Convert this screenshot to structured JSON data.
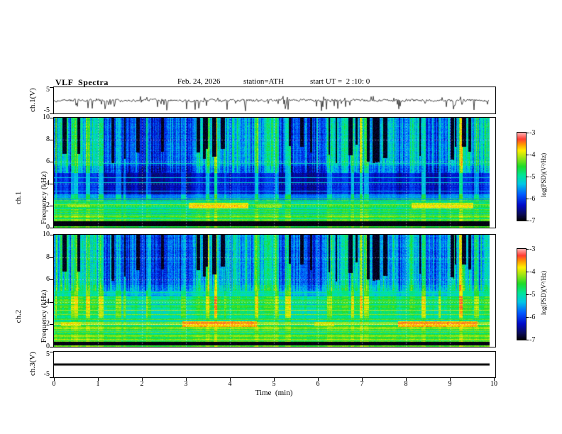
{
  "header": {
    "title": "VLF  Spectra",
    "date": "Feb. 24, 2026",
    "station": "station=ATH",
    "start_ut": "start UT =  2 :10: 0"
  },
  "axes": {
    "time_label": "Time  (min)",
    "time_ticks": [
      "0",
      "1",
      "2",
      "3",
      "4",
      "5",
      "6",
      "7",
      "8",
      "9",
      "10"
    ],
    "freq_ticks": [
      "10",
      "8",
      "6",
      "4",
      "2",
      "0"
    ],
    "volt_ticks": [
      "5",
      "-5"
    ]
  },
  "panels": {
    "ch1_wave": {
      "label": "ch.1(V)"
    },
    "ch1_spec": {
      "label_line1": "ch.1",
      "label_line2": "Frequency (kHz)"
    },
    "ch2_spec": {
      "label_line1": "ch.2",
      "label_line2": "Frequency (kHz)"
    },
    "ch3_wave": {
      "label": "ch.3(V)"
    }
  },
  "colorbar": {
    "label": "log(PSD)(V²/Hz)",
    "ticks": [
      "-3",
      "-4",
      "-5",
      "-6",
      "-7"
    ],
    "zmin": -7,
    "zmax": -3
  },
  "chart_data": [
    {
      "id": "ch1_wave",
      "type": "line",
      "ylabel": "ch.1(V)",
      "xlabel": "Time (min)",
      "xlim": [
        0,
        10
      ],
      "ylim": [
        -5,
        5
      ],
      "noise_v": 0.4,
      "spike_count": 46,
      "spike_depth_v": [
        -1.2,
        -4.6
      ],
      "spike_up_count": 16,
      "spike_up_v": [
        0.7,
        1.8
      ],
      "summary": "Broadband noisy voltage trace centered near 0 V with ~±1 V fluctuations and frequent narrow negative spikes reaching about -4.5 V across the full 0-10 min record."
    },
    {
      "id": "ch1_spec",
      "type": "heatmap",
      "ylabel": "ch.1 Frequency (kHz)",
      "xlabel": "Time (min)",
      "zlabel": "log(PSD)(V²/Hz)",
      "xlim": [
        0,
        10
      ],
      "ylim": [
        0,
        10
      ],
      "zlim": [
        -7,
        -3
      ],
      "bands": [
        [
          0,
          0.15,
          -4.6
        ],
        [
          0.15,
          0.55,
          -7
        ],
        [
          0.55,
          1.1,
          -4.65
        ],
        [
          1.1,
          2.5,
          -4.95
        ],
        [
          2.5,
          3.05,
          -5.6
        ],
        [
          3.05,
          5.0,
          -6.25
        ],
        [
          5.0,
          5.6,
          -5.85
        ],
        [
          5.6,
          10.01,
          -5.55
        ]
      ],
      "band_texture": [
        [
          0,
          0.15,
          0.05
        ],
        [
          0.55,
          2.5,
          0.45
        ],
        [
          2.5,
          5.0,
          0.1
        ],
        [
          5.0,
          10.01,
          0.12
        ]
      ],
      "hlines": [
        [
          0.8,
          -4.35
        ],
        [
          2.1,
          -4.2
        ],
        [
          2.65,
          -4.55
        ],
        [
          3.35,
          -5.45
        ],
        [
          4.15,
          -5.25
        ],
        [
          4.6,
          -5.3
        ],
        [
          5.9,
          -5.15
        ]
      ],
      "streaks": [
        [
          3.05,
          4.4,
          1.8,
          2.3,
          -3.85
        ],
        [
          8.1,
          9.5,
          1.8,
          2.3,
          -3.95
        ],
        [
          4.6,
          5.15,
          1.85,
          2.2,
          -4.35
        ],
        [
          0.3,
          0.8,
          1.9,
          2.2,
          -4.3
        ]
      ],
      "summary": "Spectrogram 0-10 kHz: dense vertical cyan/green striping above ~5.5 kHz with repeated black dropout bars extending down to ~6-7.5 kHz; dark-blue quiet band 3-5 kHz crossed by thin cyan lines near 4.15 and 4.6 kHz; green banded region below 2.5 kHz; brown/orange streaks near 2 kHz around t=3-4.4 and t=8.1-9.5 min; solid black band near 0.2-0.55 kHz; data end ~9.9 min."
    },
    {
      "id": "ch2_spec",
      "type": "heatmap",
      "ylabel": "ch.2 Frequency (kHz)",
      "xlabel": "Time (min)",
      "zlabel": "log(PSD)(V²/Hz)",
      "xlim": [
        0,
        10
      ],
      "ylim": [
        0,
        10
      ],
      "zlim": [
        -7,
        -3
      ],
      "bands": [
        [
          0,
          0.12,
          -4.45
        ],
        [
          0.12,
          0.45,
          -7
        ],
        [
          0.45,
          1.0,
          -4.4
        ],
        [
          1.0,
          2.3,
          -4.6
        ],
        [
          2.3,
          4.5,
          -4.9
        ],
        [
          4.5,
          5.5,
          -5.25
        ],
        [
          5.5,
          10.01,
          -5.55
        ]
      ],
      "band_texture": [
        [
          0,
          0.12,
          0.05
        ],
        [
          0.45,
          2.3,
          0.5
        ],
        [
          2.3,
          4.5,
          0.3
        ],
        [
          4.5,
          5.5,
          0.15
        ],
        [
          5.5,
          10.01,
          0.12
        ]
      ],
      "hlines": [
        [
          0.65,
          -4.05
        ],
        [
          1.0,
          -4.15
        ],
        [
          1.35,
          -4.25
        ],
        [
          1.7,
          -4.05
        ],
        [
          2.05,
          -3.95
        ],
        [
          2.45,
          -4.35
        ],
        [
          2.9,
          -4.2
        ],
        [
          3.3,
          -4.05
        ],
        [
          3.7,
          -4.35
        ],
        [
          4.1,
          -4.25
        ],
        [
          4.9,
          -4.85
        ]
      ],
      "streaks": [
        [
          2.9,
          4.6,
          1.8,
          2.3,
          -3.6
        ],
        [
          7.8,
          9.6,
          1.8,
          2.3,
          -3.6
        ],
        [
          5.9,
          6.35,
          1.85,
          2.25,
          -4.0
        ],
        [
          0.15,
          0.6,
          1.85,
          2.2,
          -3.9
        ]
      ],
      "summary": "Spectrogram 0-10 kHz: same striping and black dropout bars above ~5.5 kHz as ch.1; green background 2.3-4.5 kHz with yellow-green horizontal lines near 2.9, 3.3, 3.7, 4.1 kHz; strong orange/red streaks near 2 kHz around t=2.9-4.6 and t=7.8-9.6 min; dense green/yellow horizontal banding below 2.3 kHz; solid black band near 0.15-0.45 kHz; data end ~9.9 min."
    },
    {
      "id": "ch3_wave",
      "type": "line",
      "ylabel": "ch.3(V)",
      "xlabel": "Time (min)",
      "xlim": [
        0,
        10
      ],
      "ylim": [
        -5,
        5
      ],
      "constant": 0,
      "summary": "Flat thick black line at 0 V from t=0 to ~9.9 min (channel inactive)."
    }
  ],
  "render": {
    "seed": 20260224,
    "data_fraction": 0.988,
    "stripe_amp": [
      [
        0,
        3,
        0.15
      ],
      [
        3,
        5,
        0.3
      ],
      [
        5,
        10.01,
        0.6
      ]
    ],
    "pix_noise": [
      [
        0,
        5,
        0.28
      ],
      [
        5,
        10.01,
        0.5
      ]
    ],
    "fine_col_amp": 0.4,
    "bar_count": 30,
    "bar_fmin": [
      5.8,
      7.6
    ],
    "event_count": 26,
    "event_boost": [
      0.5,
      1.1
    ],
    "colormap": [
      [
        0.0,
        [
          0,
          0,
          0
        ]
      ],
      [
        0.07,
        [
          10,
          10,
          80
        ]
      ],
      [
        0.18,
        [
          0,
          10,
          200
        ]
      ],
      [
        0.3,
        [
          0,
          90,
          255
        ]
      ],
      [
        0.42,
        [
          0,
          200,
          230
        ]
      ],
      [
        0.52,
        [
          0,
          230,
          150
        ]
      ],
      [
        0.62,
        [
          30,
          220,
          40
        ]
      ],
      [
        0.72,
        [
          160,
          230,
          20
        ]
      ],
      [
        0.8,
        [
          255,
          240,
          0
        ]
      ],
      [
        0.87,
        [
          255,
          150,
          0
        ]
      ],
      [
        0.93,
        [
          255,
          60,
          50
        ]
      ],
      [
        1.0,
        [
          255,
          175,
          175
        ]
      ]
    ]
  }
}
